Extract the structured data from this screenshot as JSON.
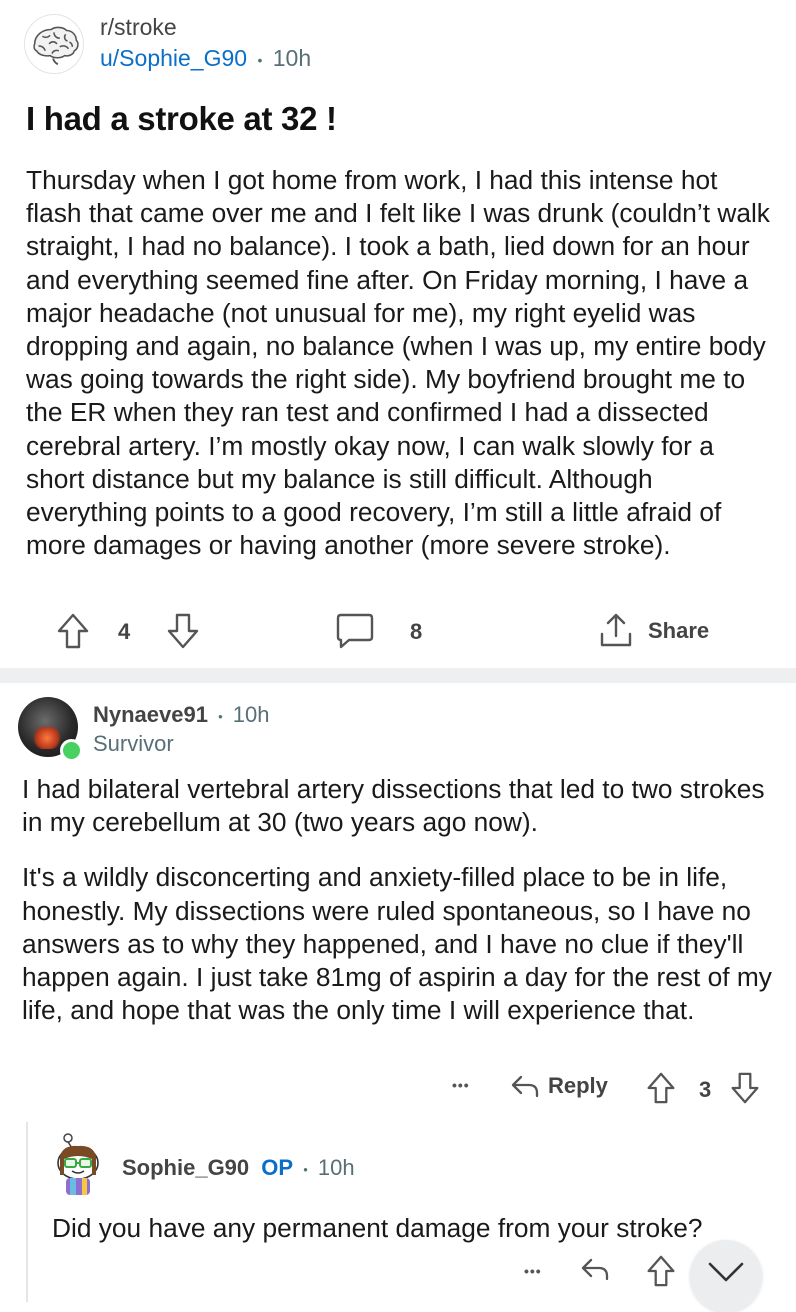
{
  "post": {
    "subreddit": "r/stroke",
    "author": "u/Sophie_G90",
    "separator": "•",
    "time": "10h",
    "title": "I had a stroke at 32 !",
    "body": "Thursday when I got home from work, I had this intense hot flash that came over me and I felt like I was drunk (couldn’t walk straight, I had no balance). I took a bath, lied down for an hour and everything seemed fine after. On Friday morning, I have a major headache (not unusual for me), my right eyelid was dropping and again, no balance (when I was up, my entire body was going towards the right side). My boyfriend brought me to the ER when they ran test and confirmed I had a dissected cerebral artery. I’m mostly okay now, I can walk slowly for a short distance but my balance is still difficult. Although everything points to a good recovery, I’m still a little afraid of more damages or having another (more severe stroke).",
    "upvotes": "4",
    "comments": "8",
    "share_label": "Share"
  },
  "comment": {
    "author": "Nynaeve91",
    "separator": "•",
    "time": "10h",
    "flair": "Survivor",
    "paragraphs": [
      "I had bilateral vertebral artery dissections that led to two strokes in my cerebellum at 30 (two years ago now).",
      "It's a wildly disconcerting and anxiety-filled place to be in life, honestly. My dissections were ruled spontaneous, so I have no answers as to why they happened, and I have no clue if they'll happen again. I just take 81mg of aspirin a day for the rest of my life, and hope that was the only time I will experience that."
    ],
    "more_label": "•••",
    "reply_label": "Reply",
    "votes": "3"
  },
  "reply": {
    "author": "Sophie_G90",
    "op_badge": "OP",
    "separator": "•",
    "time": "10h",
    "body": "Did you have any permanent damage from your stroke?",
    "more_label": "•••"
  },
  "icons": {
    "subreddit_avatar": "brain-icon",
    "upvote": "arrow-up-icon",
    "downvote": "arrow-down-icon",
    "comment": "comment-bubble-icon",
    "share": "share-icon",
    "reply": "reply-arrow-icon",
    "scroll_down": "chevron-down-icon"
  },
  "colors": {
    "link_blue": "#0b6fca",
    "online_green": "#46d160",
    "meta_gray": "#576f76"
  }
}
